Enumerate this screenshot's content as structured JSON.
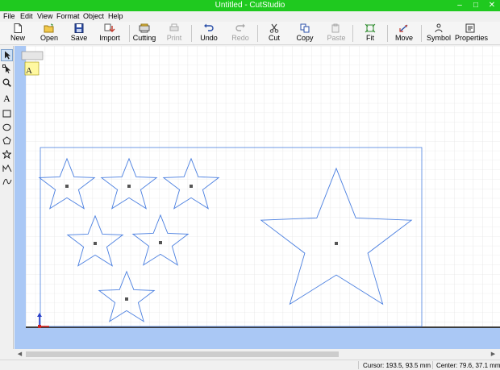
{
  "window": {
    "title": "Untitled - CutStudio",
    "min_glyph": "–",
    "max_glyph": "□",
    "close_glyph": "✕"
  },
  "menu": [
    "File",
    "Edit",
    "View",
    "Format",
    "Object",
    "Help"
  ],
  "toolbar": [
    {
      "label": "New",
      "icon": "new-file-icon",
      "enabled": true
    },
    {
      "label": "Open",
      "icon": "open-folder-icon",
      "enabled": true
    },
    {
      "label": "Save",
      "icon": "save-disk-icon",
      "enabled": true
    },
    {
      "label": "Import",
      "icon": "import-icon",
      "enabled": true
    },
    {
      "label": "Cutting",
      "icon": "cutter-icon",
      "enabled": true
    },
    {
      "label": "Print",
      "icon": "print-icon",
      "enabled": false
    },
    {
      "label": "Undo",
      "icon": "undo-icon",
      "enabled": true
    },
    {
      "label": "Redo",
      "icon": "redo-icon",
      "enabled": false
    },
    {
      "label": "Cut",
      "icon": "scissors-icon",
      "enabled": true
    },
    {
      "label": "Copy",
      "icon": "copy-icon",
      "enabled": true
    },
    {
      "label": "Paste",
      "icon": "paste-icon",
      "enabled": false
    },
    {
      "label": "Fit",
      "icon": "fit-icon",
      "enabled": true
    },
    {
      "label": "Move",
      "icon": "move-icon",
      "enabled": true
    },
    {
      "label": "Symbol",
      "icon": "symbol-icon",
      "enabled": true
    },
    {
      "label": "Properties",
      "icon": "properties-icon",
      "enabled": true
    }
  ],
  "tools": [
    {
      "name": "select-tool",
      "icon": "arrow-pointer-icon",
      "active": true
    },
    {
      "name": "node-edit-tool",
      "icon": "node-arrow-icon",
      "active": false
    },
    {
      "name": "zoom-tool",
      "icon": "magnifier-icon",
      "active": false
    },
    {
      "name": "text-tool",
      "icon": "text-a-icon",
      "glyph": "A",
      "active": false
    },
    {
      "name": "rectangle-tool",
      "icon": "rectangle-icon",
      "active": false
    },
    {
      "name": "ellipse-tool",
      "icon": "ellipse-icon",
      "active": false
    },
    {
      "name": "polygon-tool",
      "icon": "pentagon-icon",
      "active": false
    },
    {
      "name": "star-tool",
      "icon": "star-icon",
      "active": false
    },
    {
      "name": "freehand-tool",
      "icon": "freehand-icon",
      "active": false
    },
    {
      "name": "curve-tool",
      "icon": "curve-icon",
      "active": false
    }
  ],
  "canvas": {
    "background": "#ffffff",
    "margin_color": "#aac8f5",
    "outline_color": "#4a7fe0",
    "grid_color": "#dcdcdc",
    "text_object_glyph": "A"
  },
  "status": {
    "cursor": "Cursor: 193.5, 93.5 mm",
    "center": "Center: 79.6, 37.1 mm"
  },
  "colors": {
    "titlebar": "#1fc91f",
    "accent_blue": "#4a7fe0"
  }
}
